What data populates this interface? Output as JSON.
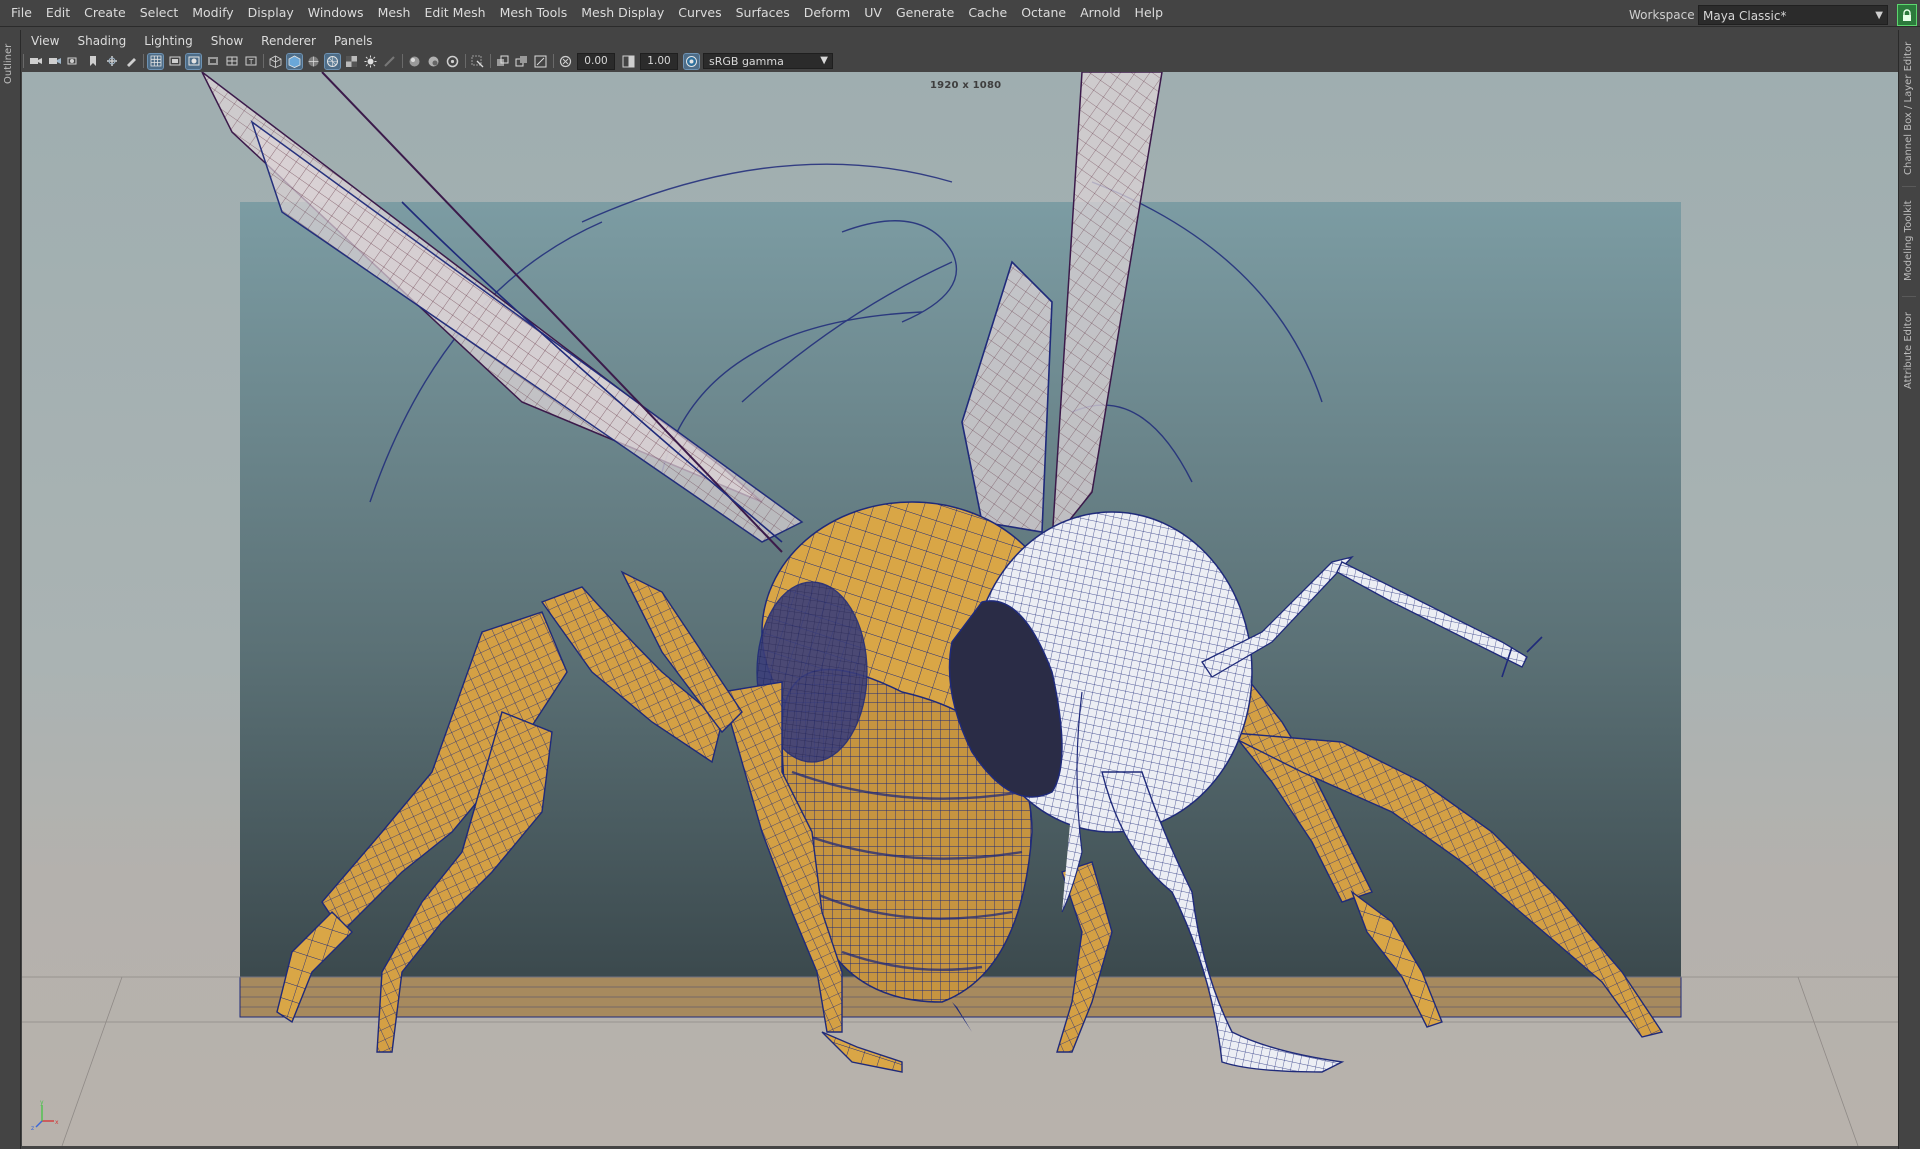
{
  "main_menu": [
    "File",
    "Edit",
    "Create",
    "Select",
    "Modify",
    "Display",
    "Windows",
    "Mesh",
    "Edit Mesh",
    "Mesh Tools",
    "Mesh Display",
    "Curves",
    "Surfaces",
    "Deform",
    "UV",
    "Generate",
    "Cache",
    "Octane",
    "Arnold",
    "Help"
  ],
  "workspace": {
    "label": "Workspace :",
    "value": "Maya Classic*"
  },
  "left_tabs": {
    "outliner": "Outliner"
  },
  "right_tabs": {
    "channel_box": "Channel Box / Layer Editor",
    "modeling_toolkit": "Modeling Toolkit",
    "attribute_editor": "Attribute Editor"
  },
  "panel_menu": [
    "View",
    "Shading",
    "Lighting",
    "Show",
    "Renderer",
    "Panels"
  ],
  "toolbar": {
    "camera_icons": [
      "camera-select-icon",
      "camera-attributes-icon",
      "camera-bookmark-icon",
      "image-plane-icon",
      "two-d-pan-zoom-icon",
      "grease-pencil-icon"
    ],
    "display_icons": [
      "grid-icon",
      "film-gate-icon",
      "resolution-gate-icon",
      "gate-mask-icon",
      "field-chart-icon",
      "safe-action-icon"
    ],
    "shading_icons": [
      "wireframe-icon",
      "smooth-shade-icon",
      "wireframe-on-shaded-icon",
      "use-default-material-icon",
      "textured-icon",
      "lights-icon",
      "shadows-icon",
      "ambient-occlusion-icon",
      "anti-aliasing-icon",
      "depth-of-field-icon",
      "isolate-select-icon",
      "xray-icon",
      "xray-joints-icon",
      "xray-active-icon",
      "exposure-icon",
      "gamma-icon",
      "color-management-icon"
    ],
    "exposure_value": "0.00",
    "gamma_value": "1.00",
    "colorspace": "sRGB gamma"
  },
  "viewport": {
    "resolution_label": "1920 x 1080"
  },
  "colors": {
    "ui_bg": "#444444",
    "wire": "#1f2a7a",
    "body": "#d9a646",
    "skin": "#ececf2",
    "backdrop_top": "#7a9aa0",
    "backdrop_bottom": "#3a4c50",
    "floor": "#a78a5e",
    "accent": "#4d6c87"
  }
}
